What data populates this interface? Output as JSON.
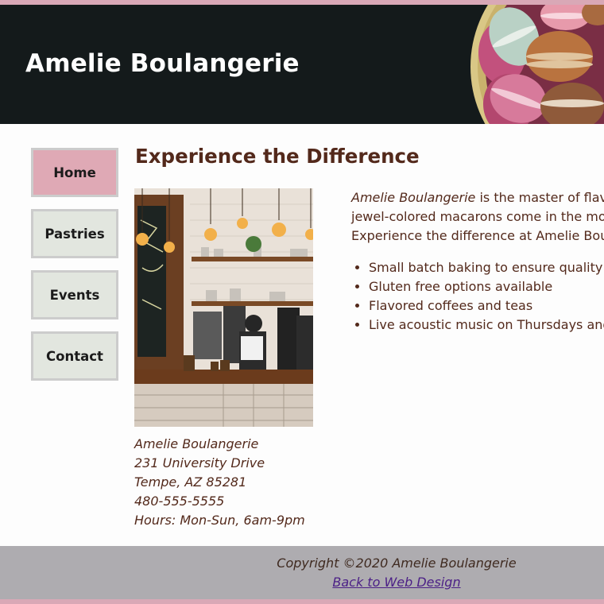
{
  "header": {
    "title": "Amelie Boulangerie",
    "image_subject": "macarons-in-bowl"
  },
  "nav": {
    "items": [
      {
        "label": "Home",
        "active": true
      },
      {
        "label": "Pastries",
        "active": false
      },
      {
        "label": "Events",
        "active": false
      },
      {
        "label": "Contact",
        "active": false
      }
    ]
  },
  "main": {
    "heading": "Experience the Difference",
    "photo_subject": "bakery-cafe-counter",
    "intro": {
      "brand": "Amelie Boulangerie",
      "line1_rest": " is the master of flav",
      "line2": "jewel-colored macarons come in the mo",
      "line3": "Experience the difference at Amelie Bou"
    },
    "features": [
      "Small batch baking to ensure quality",
      "Gluten free options available",
      "Flavored coffees and teas",
      "Live acoustic music on Thursdays and"
    ],
    "address": {
      "name": "Amelie Boulangerie",
      "street": "231 University Drive",
      "city": "Tempe, AZ 85281",
      "phone": "480-555-5555",
      "hours": "Hours: Mon-Sun, 6am-9pm"
    }
  },
  "footer": {
    "copyright": "Copyright ©2020 Amelie Boulangerie",
    "link": "Back to Web Design"
  },
  "colors": {
    "accent_pink": "#dfa9b5",
    "header_bg": "#141a1b",
    "text_brown": "#53291b",
    "footer_bg": "#aeacb0",
    "nav_bg": "#e2e6df"
  }
}
